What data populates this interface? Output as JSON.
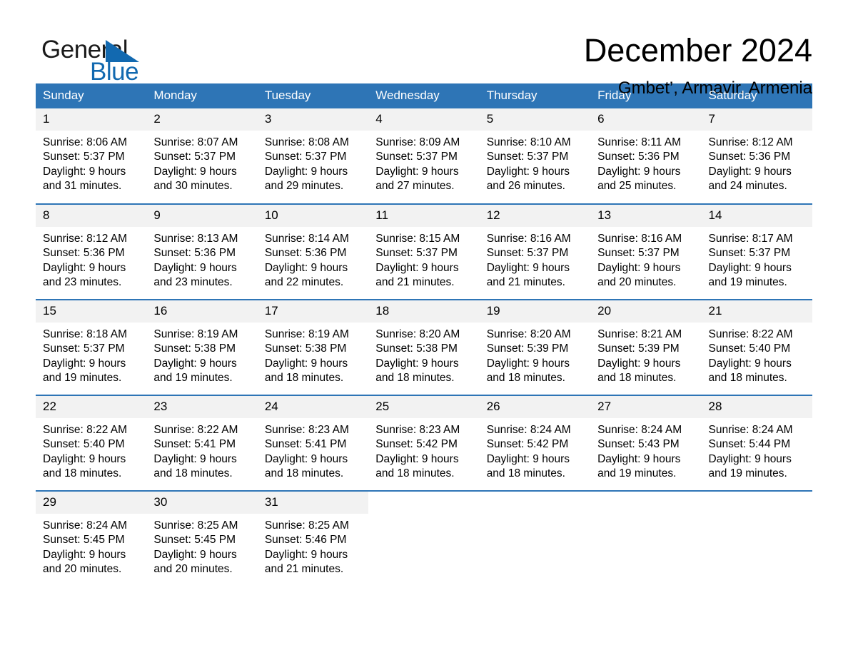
{
  "brand": {
    "name_part1": "General",
    "name_part2": "Blue",
    "flag_icon": "triangle-flag-icon",
    "accent_color": "#1269b0"
  },
  "header": {
    "month_title": "December 2024",
    "location": "Gmbet’, Armavir, Armenia"
  },
  "calendar": {
    "header_color": "#2e75b6",
    "daynum_background": "#f2f2f2",
    "weekday_headers": [
      "Sunday",
      "Monday",
      "Tuesday",
      "Wednesday",
      "Thursday",
      "Friday",
      "Saturday"
    ],
    "weeks": [
      [
        {
          "day": "1",
          "sunrise": "Sunrise: 8:06 AM",
          "sunset": "Sunset: 5:37 PM",
          "daylight_line1": "Daylight: 9 hours",
          "daylight_line2": "and 31 minutes."
        },
        {
          "day": "2",
          "sunrise": "Sunrise: 8:07 AM",
          "sunset": "Sunset: 5:37 PM",
          "daylight_line1": "Daylight: 9 hours",
          "daylight_line2": "and 30 minutes."
        },
        {
          "day": "3",
          "sunrise": "Sunrise: 8:08 AM",
          "sunset": "Sunset: 5:37 PM",
          "daylight_line1": "Daylight: 9 hours",
          "daylight_line2": "and 29 minutes."
        },
        {
          "day": "4",
          "sunrise": "Sunrise: 8:09 AM",
          "sunset": "Sunset: 5:37 PM",
          "daylight_line1": "Daylight: 9 hours",
          "daylight_line2": "and 27 minutes."
        },
        {
          "day": "5",
          "sunrise": "Sunrise: 8:10 AM",
          "sunset": "Sunset: 5:37 PM",
          "daylight_line1": "Daylight: 9 hours",
          "daylight_line2": "and 26 minutes."
        },
        {
          "day": "6",
          "sunrise": "Sunrise: 8:11 AM",
          "sunset": "Sunset: 5:36 PM",
          "daylight_line1": "Daylight: 9 hours",
          "daylight_line2": "and 25 minutes."
        },
        {
          "day": "7",
          "sunrise": "Sunrise: 8:12 AM",
          "sunset": "Sunset: 5:36 PM",
          "daylight_line1": "Daylight: 9 hours",
          "daylight_line2": "and 24 minutes."
        }
      ],
      [
        {
          "day": "8",
          "sunrise": "Sunrise: 8:12 AM",
          "sunset": "Sunset: 5:36 PM",
          "daylight_line1": "Daylight: 9 hours",
          "daylight_line2": "and 23 minutes."
        },
        {
          "day": "9",
          "sunrise": "Sunrise: 8:13 AM",
          "sunset": "Sunset: 5:36 PM",
          "daylight_line1": "Daylight: 9 hours",
          "daylight_line2": "and 23 minutes."
        },
        {
          "day": "10",
          "sunrise": "Sunrise: 8:14 AM",
          "sunset": "Sunset: 5:36 PM",
          "daylight_line1": "Daylight: 9 hours",
          "daylight_line2": "and 22 minutes."
        },
        {
          "day": "11",
          "sunrise": "Sunrise: 8:15 AM",
          "sunset": "Sunset: 5:37 PM",
          "daylight_line1": "Daylight: 9 hours",
          "daylight_line2": "and 21 minutes."
        },
        {
          "day": "12",
          "sunrise": "Sunrise: 8:16 AM",
          "sunset": "Sunset: 5:37 PM",
          "daylight_line1": "Daylight: 9 hours",
          "daylight_line2": "and 21 minutes."
        },
        {
          "day": "13",
          "sunrise": "Sunrise: 8:16 AM",
          "sunset": "Sunset: 5:37 PM",
          "daylight_line1": "Daylight: 9 hours",
          "daylight_line2": "and 20 minutes."
        },
        {
          "day": "14",
          "sunrise": "Sunrise: 8:17 AM",
          "sunset": "Sunset: 5:37 PM",
          "daylight_line1": "Daylight: 9 hours",
          "daylight_line2": "and 19 minutes."
        }
      ],
      [
        {
          "day": "15",
          "sunrise": "Sunrise: 8:18 AM",
          "sunset": "Sunset: 5:37 PM",
          "daylight_line1": "Daylight: 9 hours",
          "daylight_line2": "and 19 minutes."
        },
        {
          "day": "16",
          "sunrise": "Sunrise: 8:19 AM",
          "sunset": "Sunset: 5:38 PM",
          "daylight_line1": "Daylight: 9 hours",
          "daylight_line2": "and 19 minutes."
        },
        {
          "day": "17",
          "sunrise": "Sunrise: 8:19 AM",
          "sunset": "Sunset: 5:38 PM",
          "daylight_line1": "Daylight: 9 hours",
          "daylight_line2": "and 18 minutes."
        },
        {
          "day": "18",
          "sunrise": "Sunrise: 8:20 AM",
          "sunset": "Sunset: 5:38 PM",
          "daylight_line1": "Daylight: 9 hours",
          "daylight_line2": "and 18 minutes."
        },
        {
          "day": "19",
          "sunrise": "Sunrise: 8:20 AM",
          "sunset": "Sunset: 5:39 PM",
          "daylight_line1": "Daylight: 9 hours",
          "daylight_line2": "and 18 minutes."
        },
        {
          "day": "20",
          "sunrise": "Sunrise: 8:21 AM",
          "sunset": "Sunset: 5:39 PM",
          "daylight_line1": "Daylight: 9 hours",
          "daylight_line2": "and 18 minutes."
        },
        {
          "day": "21",
          "sunrise": "Sunrise: 8:22 AM",
          "sunset": "Sunset: 5:40 PM",
          "daylight_line1": "Daylight: 9 hours",
          "daylight_line2": "and 18 minutes."
        }
      ],
      [
        {
          "day": "22",
          "sunrise": "Sunrise: 8:22 AM",
          "sunset": "Sunset: 5:40 PM",
          "daylight_line1": "Daylight: 9 hours",
          "daylight_line2": "and 18 minutes."
        },
        {
          "day": "23",
          "sunrise": "Sunrise: 8:22 AM",
          "sunset": "Sunset: 5:41 PM",
          "daylight_line1": "Daylight: 9 hours",
          "daylight_line2": "and 18 minutes."
        },
        {
          "day": "24",
          "sunrise": "Sunrise: 8:23 AM",
          "sunset": "Sunset: 5:41 PM",
          "daylight_line1": "Daylight: 9 hours",
          "daylight_line2": "and 18 minutes."
        },
        {
          "day": "25",
          "sunrise": "Sunrise: 8:23 AM",
          "sunset": "Sunset: 5:42 PM",
          "daylight_line1": "Daylight: 9 hours",
          "daylight_line2": "and 18 minutes."
        },
        {
          "day": "26",
          "sunrise": "Sunrise: 8:24 AM",
          "sunset": "Sunset: 5:42 PM",
          "daylight_line1": "Daylight: 9 hours",
          "daylight_line2": "and 18 minutes."
        },
        {
          "day": "27",
          "sunrise": "Sunrise: 8:24 AM",
          "sunset": "Sunset: 5:43 PM",
          "daylight_line1": "Daylight: 9 hours",
          "daylight_line2": "and 19 minutes."
        },
        {
          "day": "28",
          "sunrise": "Sunrise: 8:24 AM",
          "sunset": "Sunset: 5:44 PM",
          "daylight_line1": "Daylight: 9 hours",
          "daylight_line2": "and 19 minutes."
        }
      ],
      [
        {
          "day": "29",
          "sunrise": "Sunrise: 8:24 AM",
          "sunset": "Sunset: 5:45 PM",
          "daylight_line1": "Daylight: 9 hours",
          "daylight_line2": "and 20 minutes."
        },
        {
          "day": "30",
          "sunrise": "Sunrise: 8:25 AM",
          "sunset": "Sunset: 5:45 PM",
          "daylight_line1": "Daylight: 9 hours",
          "daylight_line2": "and 20 minutes."
        },
        {
          "day": "31",
          "sunrise": "Sunrise: 8:25 AM",
          "sunset": "Sunset: 5:46 PM",
          "daylight_line1": "Daylight: 9 hours",
          "daylight_line2": "and 21 minutes."
        },
        {
          "day": "",
          "sunrise": "",
          "sunset": "",
          "daylight_line1": "",
          "daylight_line2": ""
        },
        {
          "day": "",
          "sunrise": "",
          "sunset": "",
          "daylight_line1": "",
          "daylight_line2": ""
        },
        {
          "day": "",
          "sunrise": "",
          "sunset": "",
          "daylight_line1": "",
          "daylight_line2": ""
        },
        {
          "day": "",
          "sunrise": "",
          "sunset": "",
          "daylight_line1": "",
          "daylight_line2": ""
        }
      ]
    ]
  }
}
